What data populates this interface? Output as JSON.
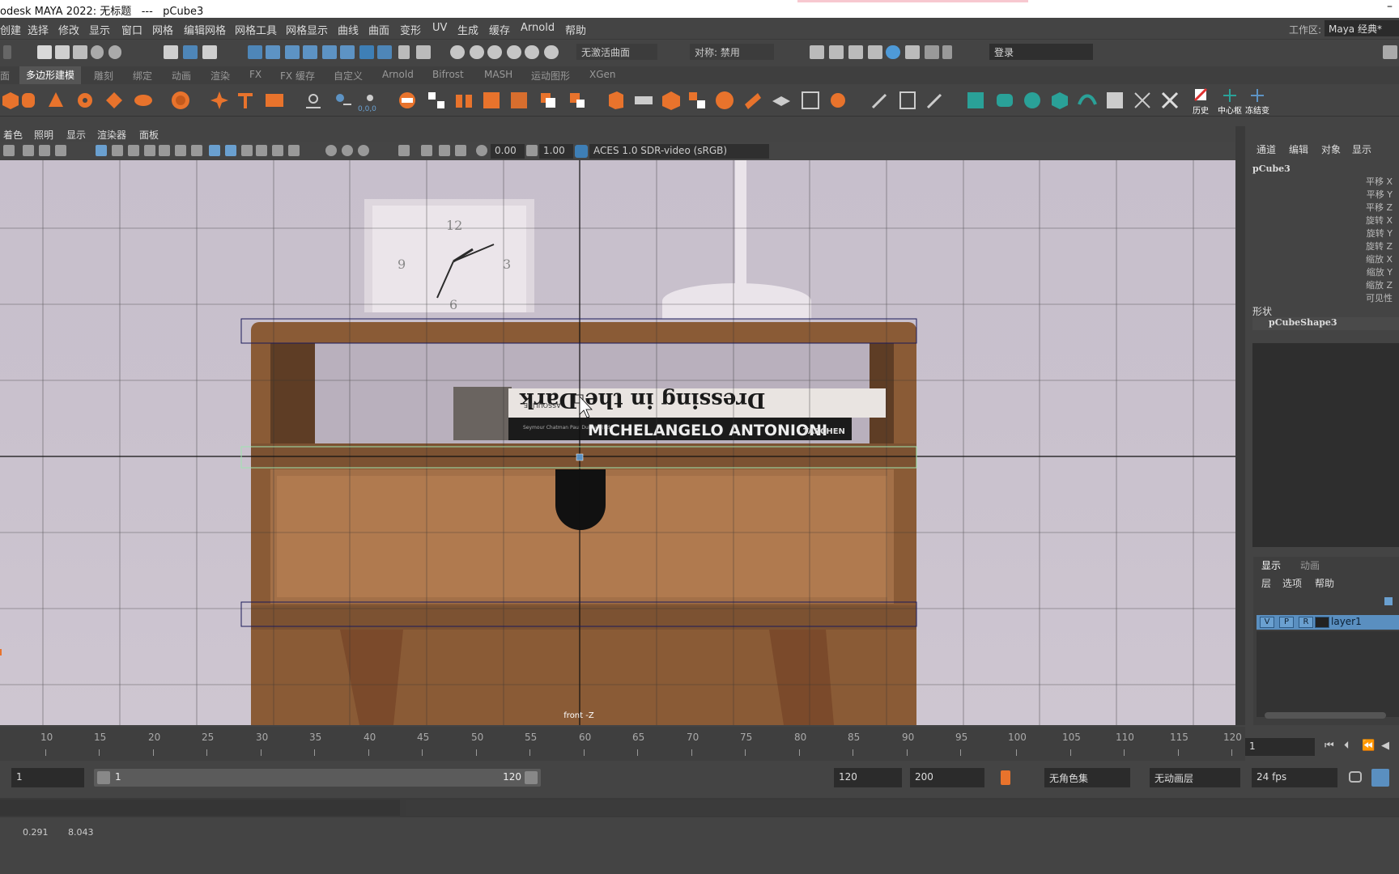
{
  "window": {
    "title": "odesk MAYA 2022: 无标题   ---   pCube3",
    "minimize_glyph": "–"
  },
  "menubar": {
    "items": [
      "创建",
      "选择",
      "修改",
      "显示",
      "窗口",
      "网格",
      "编辑网格",
      "网格工具",
      "网格显示",
      "曲线",
      "曲面",
      "变形",
      "UV",
      "生成",
      "缓存",
      "Arnold",
      "帮助"
    ],
    "workspace_label": "工作区:",
    "workspace_value": "Maya 经典*"
  },
  "statusline": {
    "live_surface": "无激活曲面",
    "symmetry": "对称: 禁用",
    "login": "登录"
  },
  "shelf_tabs": {
    "items": [
      "面",
      "多边形建模",
      "雕刻",
      "绑定",
      "动画",
      "渲染",
      "FX",
      "FX 缓存",
      "自定义",
      "Arnold",
      "Bifrost",
      "MASH",
      "运动图形",
      "XGen"
    ],
    "active_index": 1
  },
  "shelf": {
    "labels": {
      "history": "历史",
      "center_pivot": "中心枢",
      "freeze": "冻结变"
    },
    "coord_label": "0,0,0"
  },
  "viewport": {
    "menu": [
      "着色",
      "照明",
      "显示",
      "渲染器",
      "面板"
    ],
    "exposure": "0.00",
    "gamma": "1.00",
    "color_space": "ACES 1.0 SDR-video (sRGB)",
    "camera_label": "front -Z",
    "book_top_title": "Dressing in the Dark",
    "book_top_publisher": "ASSOULINE",
    "book_bottom_title": "MICHELANGELO ANTONIONI",
    "book_bottom_publisher": "TASCHEN",
    "book_bottom_authors": "Seymour Chatman Paul Duncan (Ed.)",
    "clock_numbers": [
      "12",
      "3",
      "6",
      "9"
    ]
  },
  "channel_box": {
    "tabs": [
      "通道",
      "编辑",
      "对象",
      "显示"
    ],
    "object_name": "pCube3",
    "attributes": [
      "平移 X",
      "平移 Y",
      "平移 Z",
      "旋转 X",
      "旋转 Y",
      "旋转 Z",
      "缩放 X",
      "缩放 Y",
      "缩放 Z",
      "可见性"
    ],
    "shapes_label": "形状",
    "shape_name": "pCubeShape3"
  },
  "layer_editor": {
    "tabs": [
      "显示",
      "动画"
    ],
    "menu": [
      "层",
      "选项",
      "帮助"
    ],
    "layer": {
      "v": "V",
      "p": "P",
      "r": "R",
      "name": "layer1"
    }
  },
  "timeline": {
    "ticks": [
      "10",
      "15",
      "20",
      "25",
      "30",
      "35",
      "40",
      "45",
      "50",
      "55",
      "60",
      "65",
      "70",
      "75",
      "80",
      "85",
      "90",
      "95",
      "100",
      "105",
      "110",
      "115",
      "120"
    ],
    "current_frame": "1"
  },
  "range": {
    "start": "1",
    "slider_start": "1",
    "slider_end": "120",
    "end": "120",
    "anim_end": "200",
    "char_set": "无角色集",
    "anim_layer": "无动画层",
    "fps": "24 fps"
  },
  "helpline": {
    "value_a": "0.291",
    "value_b": "8.043"
  },
  "colors": {
    "maya_bg": "#444444",
    "selection_blue": "#5a8fc0",
    "shelf_accent": "#e8732c"
  }
}
